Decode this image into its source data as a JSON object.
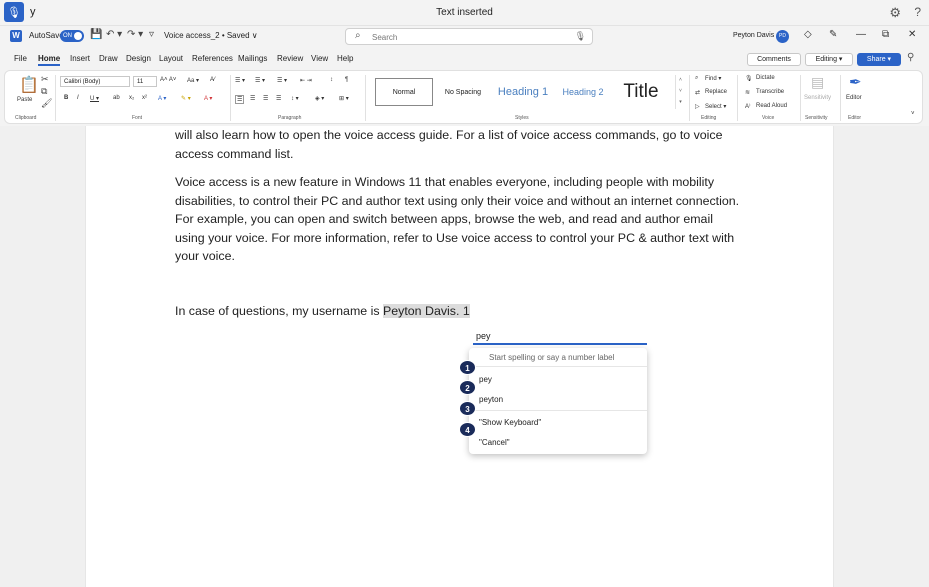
{
  "voice_access": {
    "command_text": "y",
    "status": "Text inserted",
    "icons": [
      "microphone-icon",
      "gear-icon",
      "help-icon"
    ]
  },
  "titlebar": {
    "autosave_label": "AutoSave",
    "autosave_state": "ON",
    "doc_name": "Voice access_2 • Saved ∨",
    "search_placeholder": "Search",
    "user_name": "Peyton Davis",
    "user_initials": "PD"
  },
  "menu": {
    "tabs": [
      "File",
      "Home",
      "Insert",
      "Draw",
      "Design",
      "Layout",
      "References",
      "Mailings",
      "Review",
      "View",
      "Help"
    ],
    "active_tab": "Home",
    "comments_label": "Comments",
    "editing_label": "Editing ▾",
    "share_label": "Share ▾"
  },
  "ribbon": {
    "clipboard": {
      "paste_label": "Paste",
      "group_label": "Clipboard"
    },
    "font": {
      "font_name": "Calibri (Body)",
      "font_size": "11",
      "group_label": "Font"
    },
    "paragraph": {
      "group_label": "Paragraph"
    },
    "styles": {
      "normal": "Normal",
      "no_spacing": "No Spacing",
      "heading1": "Heading 1",
      "heading2": "Heading 2",
      "title": "Title",
      "group_label": "Styles"
    },
    "editing": {
      "find": "Find ▾",
      "replace": "Replace",
      "select": "Select ▾",
      "group_label": "Editing"
    },
    "voice": {
      "dictate": "Dictate",
      "transcribe": "Transcribe",
      "read_aloud": "Read Aloud",
      "group_label": "Voice"
    },
    "sensitivity": {
      "label": "Sensitivity",
      "group_label": "Sensitivity"
    },
    "editor": {
      "label": "Editor",
      "group_label": "Editor"
    },
    "accent_color": "#2b63c7"
  },
  "document": {
    "para1": "will also learn how to open the voice access guide. For a list of voice access commands, go to voice access command list.",
    "para2": "Voice access is a new feature in Windows 11 that enables everyone, including people with mobility disabilities, to control their PC and author text using only their voice and without an internet connection. For example, you can open and switch between apps, browse the web, and read and author email using your voice. For more information, refer to Use voice access to control your PC & author text with your voice.",
    "para3_prefix": "In case of questions, my username is ",
    "para3_selected": "Peyton Davis. 1"
  },
  "correction": {
    "input_value": "pey",
    "hint": "Start spelling or say a number label",
    "items": [
      {
        "number": "1",
        "label": ""
      },
      {
        "number": "2",
        "label": "pey"
      },
      {
        "number": "3",
        "label": "peyton"
      },
      {
        "number": "4",
        "label": "\"Show Keyboard\""
      },
      {
        "number": "",
        "label": "\"Cancel\""
      }
    ]
  }
}
